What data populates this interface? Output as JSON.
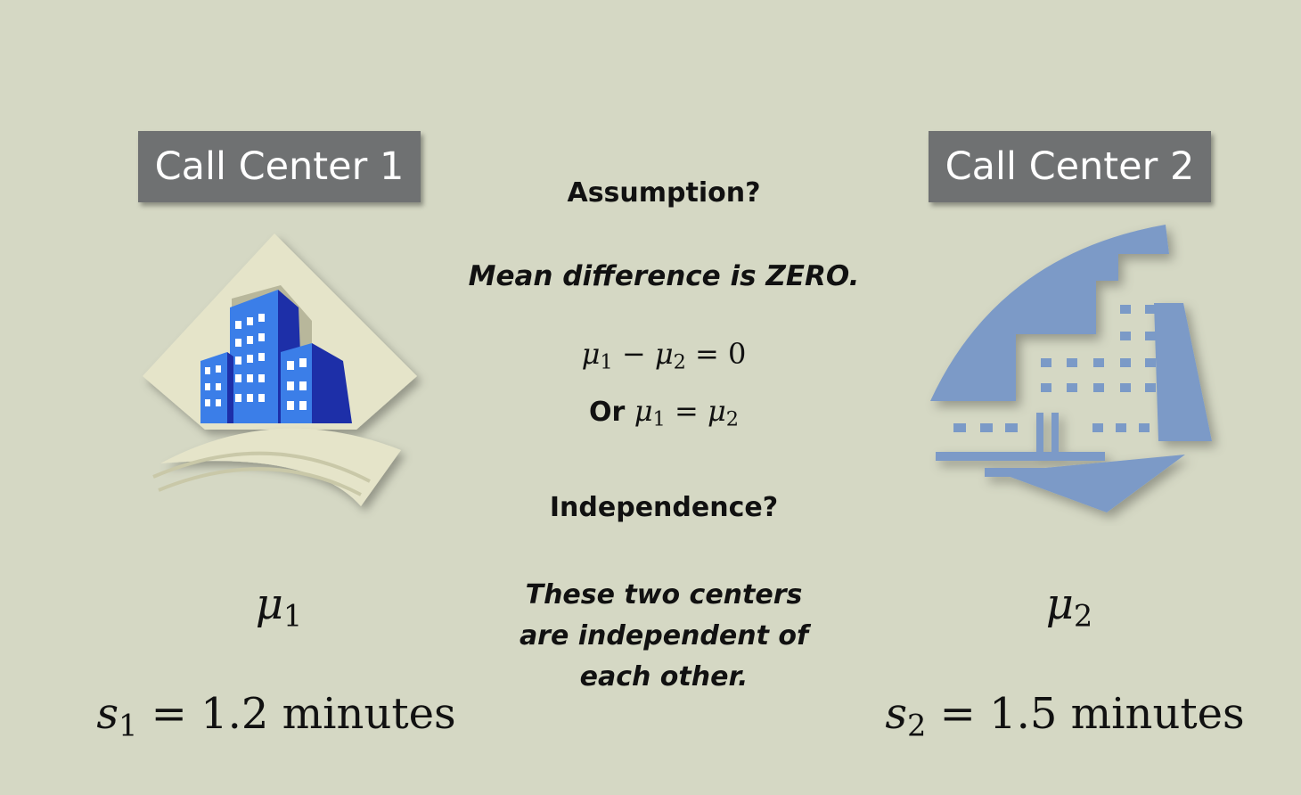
{
  "left": {
    "title": "Call Center 1",
    "mu": "μ",
    "mu_sub": "1",
    "s": "s",
    "s_sub": "1",
    "s_eq": " = 1.2 minutes"
  },
  "right": {
    "title": "Call Center 2",
    "mu": "μ",
    "mu_sub": "2",
    "s": "s",
    "s_sub": "2",
    "s_eq": " = 1.5 minutes"
  },
  "center": {
    "assumption_heading": "Assumption?",
    "assumption_text": "Mean difference is ZERO.",
    "eq1": {
      "a": "μ",
      "a_sub": "1",
      "op": " − ",
      "b": "μ",
      "b_sub": "2",
      "rest": " = 0"
    },
    "eq2": {
      "prefix": "Or ",
      "a": "μ",
      "a_sub": "1",
      "op": " = ",
      "b": "μ",
      "b_sub": "2"
    },
    "independence_heading": "Independence?",
    "independence_lines": [
      "These two centers",
      "are independent of",
      "each other."
    ]
  },
  "icons": {
    "left": "office-buildings-icon",
    "right": "office-building-icon"
  },
  "colors": {
    "background": "#d5d8c4",
    "tag_bg": "#6f7172",
    "building_blue": "#3b7ee8",
    "building_dark": "#1d2fa8",
    "right_icon_blue": "#7b9ac7",
    "diamond": "#e5e4c9"
  }
}
